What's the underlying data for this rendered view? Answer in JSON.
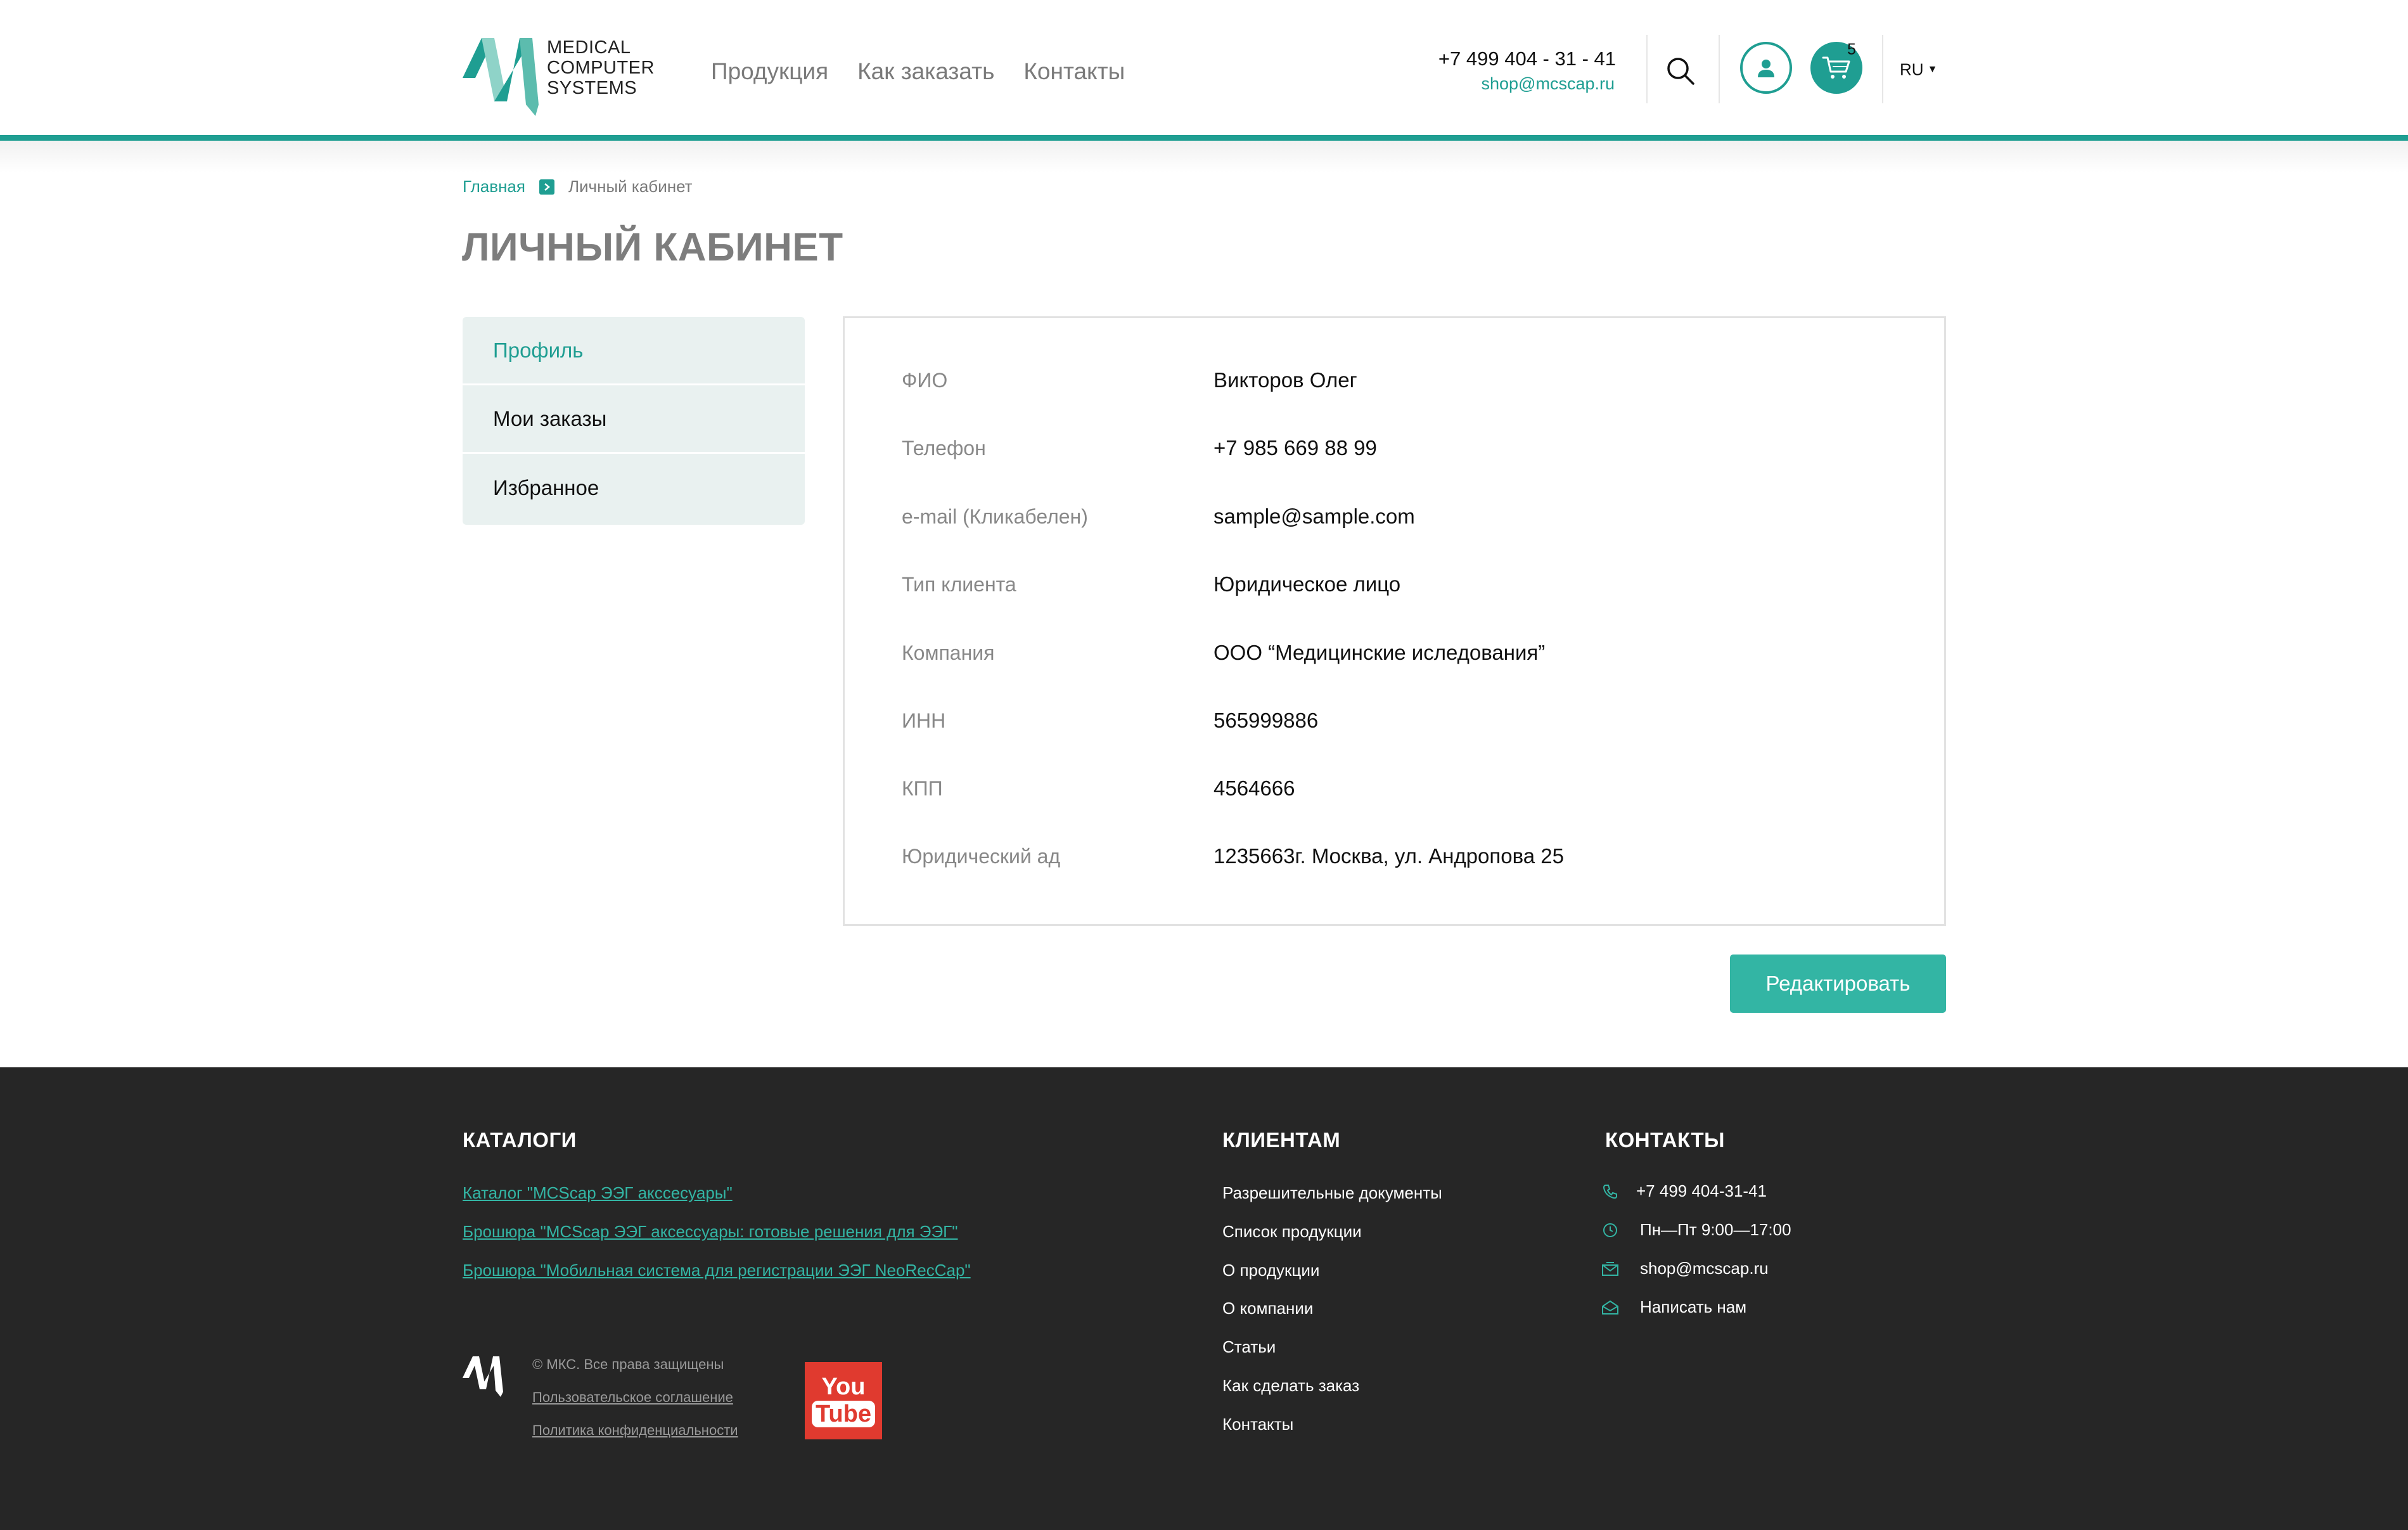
{
  "brand": {
    "name_lines": [
      "MEDICAL",
      "COMPUTER",
      "SYSTEMS"
    ],
    "accent": "#1f9e92",
    "button_color": "#33b5a4",
    "footer_bg": "#262626"
  },
  "nav": {
    "items": [
      "Продукция",
      "Как заказать",
      "Контакты"
    ]
  },
  "header": {
    "phone": "+7 499 404 - 31 - 41",
    "email": "shop@mcscap.ru",
    "cart_count": "5",
    "lang": "RU",
    "icons": [
      "search-icon",
      "user-icon",
      "cart-icon",
      "caret-down-icon"
    ]
  },
  "breadcrumb": {
    "home": "Главная",
    "current": "Личный кабинет"
  },
  "page": {
    "title": "ЛИЧНЫЙ КАБИНЕТ"
  },
  "side_menu": {
    "items": [
      {
        "label": "Профиль",
        "active": true
      },
      {
        "label": "Мои заказы",
        "active": false
      },
      {
        "label": "Избранное",
        "active": false
      }
    ]
  },
  "profile": {
    "fields": [
      {
        "label": "ФИО",
        "value": "Викторов Олег"
      },
      {
        "label": "Телефон",
        "value": "+7 985 669 88 99"
      },
      {
        "label": "e-mail (Кликабелен)",
        "value": "sample@sample.com"
      },
      {
        "label": "Тип клиента",
        "value": "Юридическое лицо"
      },
      {
        "label": "Компания",
        "value": "ООО “Медицинские иследования”"
      },
      {
        "label": "ИНН",
        "value": "565999886"
      },
      {
        "label": "КПП",
        "value": "4564666"
      },
      {
        "label": "Юридический ад",
        "value": "1235663г. Москва, ул. Андропова 25"
      }
    ],
    "edit_label": "Редактировать"
  },
  "footer": {
    "catalogs": {
      "heading": "КАТАЛОГИ",
      "links": [
        "Каталог \"MCScap ЭЭГ акссесуары\"",
        "Брошюра \"MCScap ЭЭГ аксессуары: готовые решения для ЭЭГ\"",
        "Брошюра \"Мобильная система для регистрации ЭЭГ NeoRecCap\""
      ]
    },
    "clients": {
      "heading": "КЛИЕНТАМ",
      "links": [
        "Разрешительные документы",
        "Список продукции",
        "О продукции",
        "О компании",
        "Статьи",
        "Как сделать заказ",
        "Контакты"
      ]
    },
    "contacts": {
      "heading": "КОНТАКТЫ",
      "items": [
        {
          "icon": "phone-icon",
          "text": "+7 499 404-31-41"
        },
        {
          "icon": "clock-icon",
          "text": "Пн—Пт 9:00—17:00"
        },
        {
          "icon": "mail-icon",
          "text": "shop@mcscap.ru"
        },
        {
          "icon": "mail-open-icon",
          "text": "Написать нам"
        }
      ]
    },
    "copyright": "© МКС. Все права защищены",
    "legal_links": [
      "Пользовательское соглашение",
      "Политика конфиденциальности"
    ],
    "youtube": {
      "you": "You",
      "tube": "Tube"
    }
  }
}
